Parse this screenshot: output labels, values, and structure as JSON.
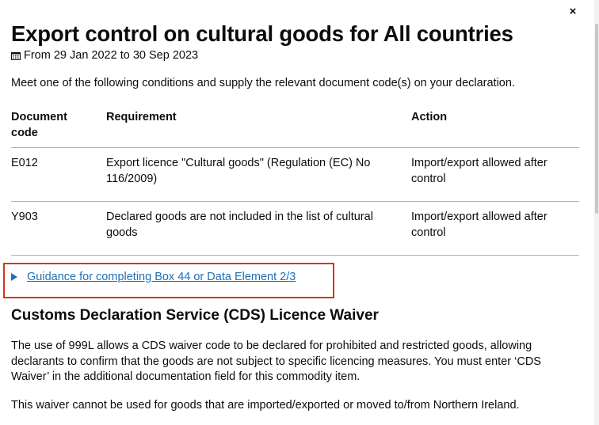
{
  "close_label": "×",
  "title": "Export control on cultural goods for All countries",
  "dates": "From 29 Jan 2022 to 30 Sep 2023",
  "intro": "Meet one of the following conditions and supply the relevant document code(s) on your declaration.",
  "table": {
    "headers": {
      "code": "Document code",
      "requirement": "Requirement",
      "action": "Action"
    },
    "rows": [
      {
        "code": "E012",
        "requirement": "Export licence \"Cultural goods\" (Regulation (EC) No 116/2009)",
        "action": "Import/export allowed after control"
      },
      {
        "code": "Y903",
        "requirement": "Declared goods are not included in the list of cultural goods",
        "action": "Import/export allowed after control"
      }
    ]
  },
  "guidance_link": "Guidance for completing Box 44 or Data Element 2/3",
  "cds": {
    "heading": "Customs Declaration Service (CDS) Licence Waiver",
    "para1": "The use of 999L allows a CDS waiver code to be declared for prohibited and restricted goods, allowing declarants to confirm that the goods are not subject to specific licencing measures. You must enter ‘CDS Waiver’ in the additional documentation field for this commodity item.",
    "para2": "This waiver cannot be used for goods that are imported/exported or moved to/from Northern Ireland."
  },
  "colors": {
    "link": "#1d70b8",
    "highlight_border": "#d4351c",
    "text": "#0b0c0c",
    "rule": "#b1b4b6"
  },
  "icons": {
    "close": "close-icon",
    "calendar": "calendar-icon",
    "expander": "triangle-right-icon"
  }
}
